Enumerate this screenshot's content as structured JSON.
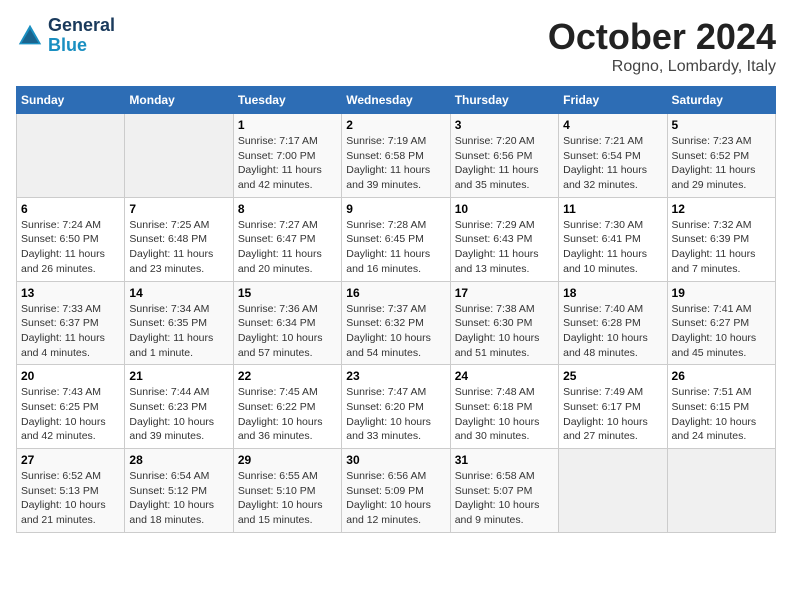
{
  "header": {
    "logo_line1": "General",
    "logo_line2": "Blue",
    "month": "October 2024",
    "location": "Rogno, Lombardy, Italy"
  },
  "weekdays": [
    "Sunday",
    "Monday",
    "Tuesday",
    "Wednesday",
    "Thursday",
    "Friday",
    "Saturday"
  ],
  "weeks": [
    [
      {
        "day": "",
        "info": ""
      },
      {
        "day": "",
        "info": ""
      },
      {
        "day": "1",
        "info": "Sunrise: 7:17 AM\nSunset: 7:00 PM\nDaylight: 11 hours and 42 minutes."
      },
      {
        "day": "2",
        "info": "Sunrise: 7:19 AM\nSunset: 6:58 PM\nDaylight: 11 hours and 39 minutes."
      },
      {
        "day": "3",
        "info": "Sunrise: 7:20 AM\nSunset: 6:56 PM\nDaylight: 11 hours and 35 minutes."
      },
      {
        "day": "4",
        "info": "Sunrise: 7:21 AM\nSunset: 6:54 PM\nDaylight: 11 hours and 32 minutes."
      },
      {
        "day": "5",
        "info": "Sunrise: 7:23 AM\nSunset: 6:52 PM\nDaylight: 11 hours and 29 minutes."
      }
    ],
    [
      {
        "day": "6",
        "info": "Sunrise: 7:24 AM\nSunset: 6:50 PM\nDaylight: 11 hours and 26 minutes."
      },
      {
        "day": "7",
        "info": "Sunrise: 7:25 AM\nSunset: 6:48 PM\nDaylight: 11 hours and 23 minutes."
      },
      {
        "day": "8",
        "info": "Sunrise: 7:27 AM\nSunset: 6:47 PM\nDaylight: 11 hours and 20 minutes."
      },
      {
        "day": "9",
        "info": "Sunrise: 7:28 AM\nSunset: 6:45 PM\nDaylight: 11 hours and 16 minutes."
      },
      {
        "day": "10",
        "info": "Sunrise: 7:29 AM\nSunset: 6:43 PM\nDaylight: 11 hours and 13 minutes."
      },
      {
        "day": "11",
        "info": "Sunrise: 7:30 AM\nSunset: 6:41 PM\nDaylight: 11 hours and 10 minutes."
      },
      {
        "day": "12",
        "info": "Sunrise: 7:32 AM\nSunset: 6:39 PM\nDaylight: 11 hours and 7 minutes."
      }
    ],
    [
      {
        "day": "13",
        "info": "Sunrise: 7:33 AM\nSunset: 6:37 PM\nDaylight: 11 hours and 4 minutes."
      },
      {
        "day": "14",
        "info": "Sunrise: 7:34 AM\nSunset: 6:35 PM\nDaylight: 11 hours and 1 minute."
      },
      {
        "day": "15",
        "info": "Sunrise: 7:36 AM\nSunset: 6:34 PM\nDaylight: 10 hours and 57 minutes."
      },
      {
        "day": "16",
        "info": "Sunrise: 7:37 AM\nSunset: 6:32 PM\nDaylight: 10 hours and 54 minutes."
      },
      {
        "day": "17",
        "info": "Sunrise: 7:38 AM\nSunset: 6:30 PM\nDaylight: 10 hours and 51 minutes."
      },
      {
        "day": "18",
        "info": "Sunrise: 7:40 AM\nSunset: 6:28 PM\nDaylight: 10 hours and 48 minutes."
      },
      {
        "day": "19",
        "info": "Sunrise: 7:41 AM\nSunset: 6:27 PM\nDaylight: 10 hours and 45 minutes."
      }
    ],
    [
      {
        "day": "20",
        "info": "Sunrise: 7:43 AM\nSunset: 6:25 PM\nDaylight: 10 hours and 42 minutes."
      },
      {
        "day": "21",
        "info": "Sunrise: 7:44 AM\nSunset: 6:23 PM\nDaylight: 10 hours and 39 minutes."
      },
      {
        "day": "22",
        "info": "Sunrise: 7:45 AM\nSunset: 6:22 PM\nDaylight: 10 hours and 36 minutes."
      },
      {
        "day": "23",
        "info": "Sunrise: 7:47 AM\nSunset: 6:20 PM\nDaylight: 10 hours and 33 minutes."
      },
      {
        "day": "24",
        "info": "Sunrise: 7:48 AM\nSunset: 6:18 PM\nDaylight: 10 hours and 30 minutes."
      },
      {
        "day": "25",
        "info": "Sunrise: 7:49 AM\nSunset: 6:17 PM\nDaylight: 10 hours and 27 minutes."
      },
      {
        "day": "26",
        "info": "Sunrise: 7:51 AM\nSunset: 6:15 PM\nDaylight: 10 hours and 24 minutes."
      }
    ],
    [
      {
        "day": "27",
        "info": "Sunrise: 6:52 AM\nSunset: 5:13 PM\nDaylight: 10 hours and 21 minutes."
      },
      {
        "day": "28",
        "info": "Sunrise: 6:54 AM\nSunset: 5:12 PM\nDaylight: 10 hours and 18 minutes."
      },
      {
        "day": "29",
        "info": "Sunrise: 6:55 AM\nSunset: 5:10 PM\nDaylight: 10 hours and 15 minutes."
      },
      {
        "day": "30",
        "info": "Sunrise: 6:56 AM\nSunset: 5:09 PM\nDaylight: 10 hours and 12 minutes."
      },
      {
        "day": "31",
        "info": "Sunrise: 6:58 AM\nSunset: 5:07 PM\nDaylight: 10 hours and 9 minutes."
      },
      {
        "day": "",
        "info": ""
      },
      {
        "day": "",
        "info": ""
      }
    ]
  ]
}
